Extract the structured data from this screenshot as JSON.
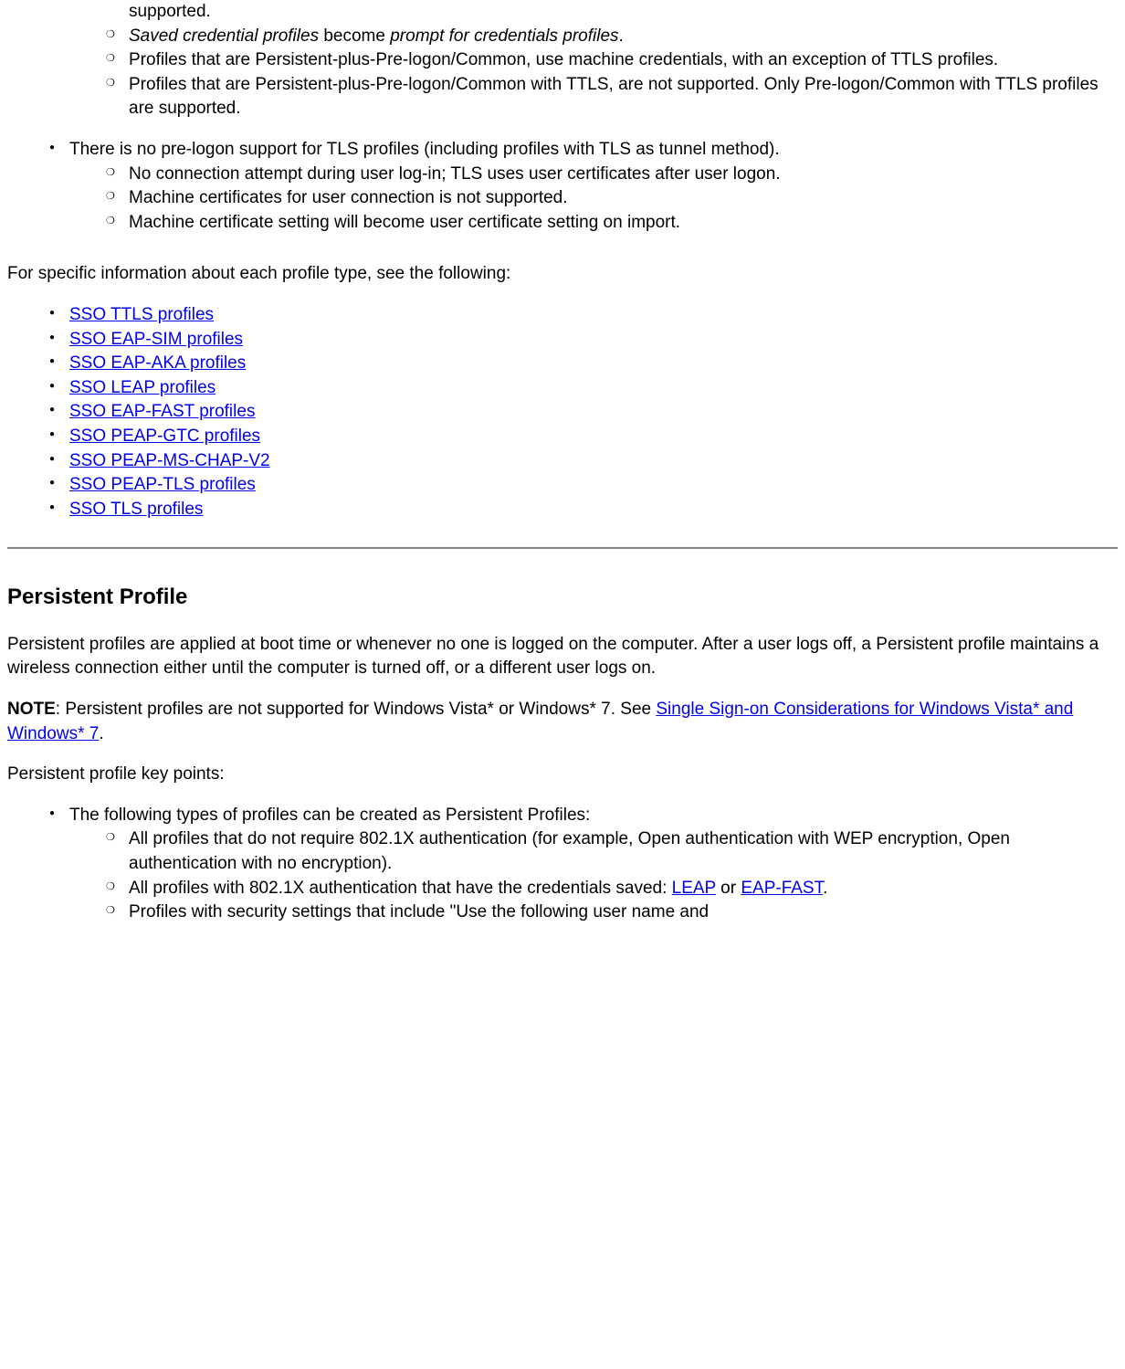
{
  "top_fragment": {
    "supported": "supported.",
    "sub1_italic1": "Saved credential profiles",
    "sub1_mid": " become ",
    "sub1_italic2": "prompt for credentials profiles",
    "sub1_end": ".",
    "sub2": "Profiles that are Persistent-plus-Pre-logon/Common, use machine credentials, with an exception of TTLS profiles.",
    "sub3": "Profiles that are Persistent-plus-Pre-logon/Common with TTLS, are not supported. Only Pre-logon/Common with TTLS profiles are supported.",
    "item2": "There is no pre-logon support for TLS profiles (including profiles with TLS as tunnel method).",
    "item2_sub1": "No connection attempt during user log-in; TLS uses user certificates after user logon.",
    "item2_sub2": "Machine certificates for user connection is not supported.",
    "item2_sub3": "Machine certificate setting will become user certificate setting on import."
  },
  "intro_specific": "For specific information about each profile type, see the following:",
  "links": {
    "l1": "SSO TTLS profiles",
    "l2": "SSO EAP-SIM profiles",
    "l3": "SSO EAP-AKA profiles",
    "l4": "SSO LEAP profiles",
    "l5": "SSO EAP-FAST profiles",
    "l6": "SSO PEAP-GTC profiles",
    "l7": "SSO PEAP-MS-CHAP-V2",
    "l8": "SSO PEAP-TLS profiles",
    "l9": "SSO TLS profiles"
  },
  "heading": "Persistent Profile",
  "persistent_para": "Persistent profiles are applied at boot time or whenever no one is logged on the computer. After a user logs off, a Persistent profile maintains a wireless connection either until the computer is turned off, or a different user logs on.",
  "note_label": "NOTE",
  "note_text1": ": Persistent profiles are not supported for Windows Vista* or Windows* 7. See ",
  "note_link": "Single Sign-on Considerations for Windows Vista* and Windows* 7",
  "note_text2": ".",
  "keypoints_intro": "Persistent profile key points:",
  "keypoints": {
    "item1": "The following types of profiles can be created as Persistent Profiles:",
    "sub1": "All profiles that do not require 802.1X authentication (for example, Open authentication with WEP encryption, Open authentication with no encryption).",
    "sub2_a": "All profiles with 802.1X authentication that have the credentials saved: ",
    "sub2_link1": "LEAP",
    "sub2_b": " or ",
    "sub2_link2": "EAP-FAST",
    "sub2_c": ".",
    "sub3": "Profiles with security settings that include \"Use the following user name and"
  }
}
